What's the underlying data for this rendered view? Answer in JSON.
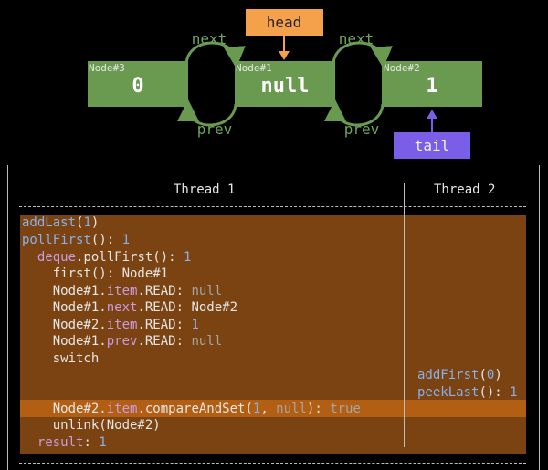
{
  "diagram": {
    "head_label": "head",
    "tail_label": "tail",
    "next_label": "next",
    "prev_label": "prev",
    "nodes": [
      {
        "id": "Node#3",
        "value": "0"
      },
      {
        "id": "Node#1",
        "value": "null"
      },
      {
        "id": "Node#2",
        "value": "1"
      }
    ],
    "colors": {
      "node": "#6a9a4f",
      "head": "#f5a04a",
      "tail": "#7b5ee8",
      "arrow": "#6a9a4f"
    }
  },
  "table": {
    "thread1_header": "Thread 1",
    "thread2_header": "Thread 2",
    "thread1_lines": [
      [
        "addLast",
        "(",
        "1",
        ")"
      ],
      [
        "pollFirst",
        "(): ",
        "1"
      ],
      [
        "  ",
        "deque",
        ".pollFirst(): ",
        "1"
      ],
      [
        "    first(): Node#1"
      ],
      [
        "    Node#1.",
        "item",
        ".READ: ",
        "null"
      ],
      [
        "    Node#1.",
        "next",
        ".READ: Node#2"
      ],
      [
        "    Node#2.",
        "item",
        ".READ: ",
        "1"
      ],
      [
        "    Node#1.",
        "prev",
        ".READ: ",
        "null"
      ],
      [
        "    switch"
      ],
      [
        "    Node#2.",
        "item",
        ".compareAndSet(",
        "1",
        ", ",
        "null",
        "): ",
        "true"
      ],
      [
        "    unlink(Node#2)"
      ],
      [
        "  ",
        "result",
        ": ",
        "1"
      ]
    ],
    "thread2_lines": [
      [
        "addFirst",
        "(",
        "0",
        ")"
      ],
      [
        "peekLast",
        "(): ",
        "1"
      ]
    ]
  }
}
